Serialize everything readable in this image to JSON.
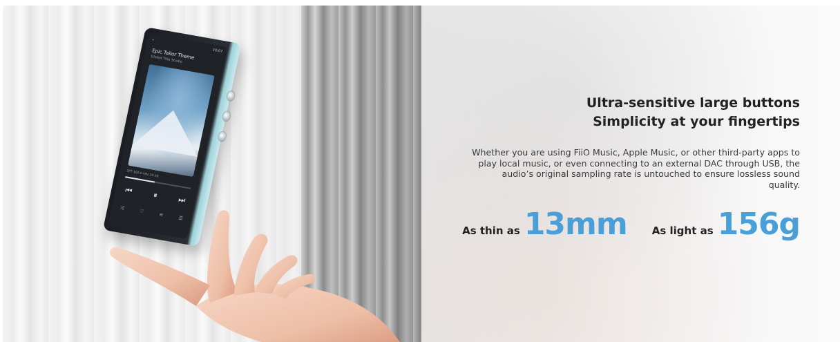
{
  "device_screen": {
    "status_left": "",
    "status_right": "10:07",
    "track_title": "Epic Tailor Theme",
    "track_artist": "Global Title Studio",
    "format_line": "SPT 192.0 kHz 24 bit",
    "progress_fraction": 0.45,
    "controls": [
      "⏮",
      "⏸",
      "⏭"
    ]
  },
  "headline": {
    "line1": "Ultra-sensitive large buttons",
    "line2": "Simplicity at your fingertips"
  },
  "description": "Whether you are using FiiO Music, Apple Music, or other third-party apps to play local music, or even connecting to an external DAC through USB, the audio’s original sampling rate is untouched to ensure lossless sound quality.",
  "stats": [
    {
      "label": "As thin as",
      "value": "13mm"
    },
    {
      "label": "As light as",
      "value": "156g"
    }
  ],
  "colors": {
    "accent": "#4a9fd8",
    "text_dark": "#222222",
    "device_teal": "#bfe3e9"
  }
}
